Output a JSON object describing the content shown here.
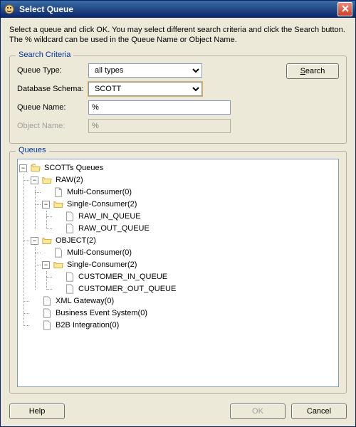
{
  "window": {
    "title": "Select Queue",
    "instructions": "Select a queue and click OK. You may select different search criteria and click the Search button. The % wildcard can be used in the Queue Name or Object Name."
  },
  "search": {
    "legend": "Search Criteria",
    "queueTypeLabel": "Queue Type:",
    "queueTypeOptions": [
      "all types"
    ],
    "queueTypeValue": "all types",
    "dbSchemaLabel": "Database Schema:",
    "dbSchemaOptions": [
      "SCOTT"
    ],
    "dbSchemaValue": "SCOTT",
    "queueNameLabel": "Queue Name:",
    "queueNameValue": "%",
    "objectNameLabel": "Object Name:",
    "objectNameValue": "%",
    "searchButton": "Search"
  },
  "queues": {
    "legend": "Queues",
    "root": "SCOTTs Queues",
    "raw": "RAW(2)",
    "rawMulti": "Multi-Consumer(0)",
    "rawSingle": "Single-Consumer(2)",
    "rawInQ": "RAW_IN_QUEUE",
    "rawOutQ": "RAW_OUT_QUEUE",
    "object": "OBJECT(2)",
    "objMulti": "Multi-Consumer(0)",
    "objSingle": "Single-Consumer(2)",
    "custInQ": "CUSTOMER_IN_QUEUE",
    "custOutQ": "CUSTOMER_OUT_QUEUE",
    "xmlGateway": "XML Gateway(0)",
    "bes": "Business Event System(0)",
    "b2b": "B2B Integration(0)"
  },
  "buttons": {
    "help": "Help",
    "ok": "OK",
    "cancel": "Cancel"
  }
}
